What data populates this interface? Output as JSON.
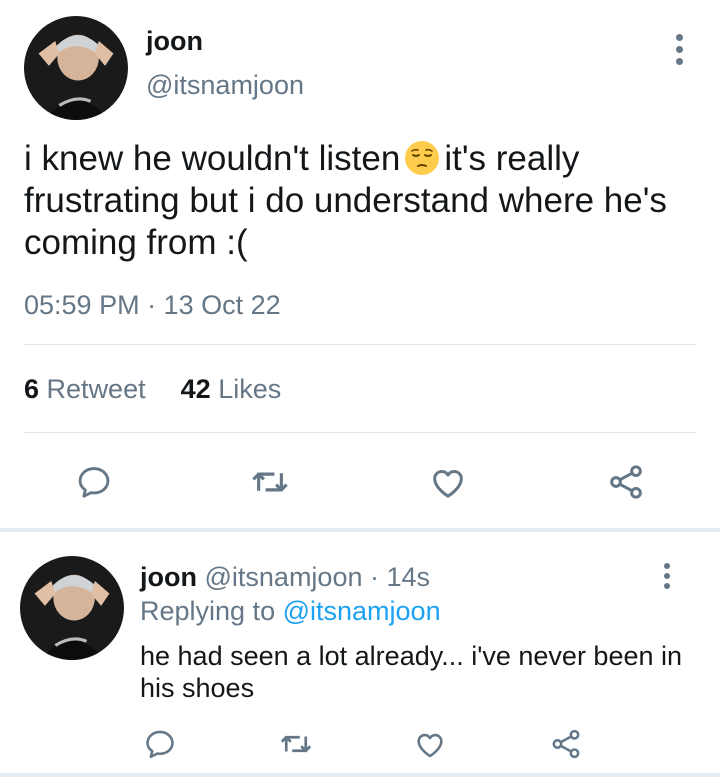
{
  "main_tweet": {
    "display_name": "joon",
    "handle": "@itsnamjoon",
    "text_before_emoji": "i knew he wouldn't listen",
    "emoji": "pensive-face-emoji",
    "text_after_emoji": "it's really frustrating but i do understand where he's coming from :(",
    "timestamp": "05:59 PM · 13 Oct 22",
    "retweet_count": "6",
    "retweet_label": "Retweet",
    "like_count": "42",
    "like_label": "Likes"
  },
  "reply": {
    "display_name": "joon",
    "handle_time": "@itsnamjoon · 14s",
    "replying_label": "Replying to",
    "replying_handle": "@itsnamjoon",
    "text": "he had seen a lot already... i've never been in his shoes"
  },
  "colors": {
    "text_primary": "#14171a",
    "text_secondary": "#657786",
    "link": "#1da1f2",
    "divider": "#e1e8ed"
  },
  "icons": [
    "reply-icon",
    "retweet-icon",
    "like-icon",
    "share-icon",
    "more-options-icon"
  ]
}
